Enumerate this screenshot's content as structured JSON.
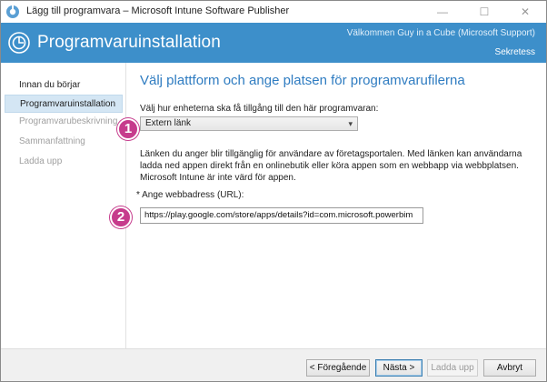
{
  "window": {
    "title": "Lägg till programvara – Microsoft Intune Software Publisher",
    "controls": {
      "minimize": "—",
      "maximize": "☐",
      "close": "✕"
    }
  },
  "banner": {
    "title": "Programvaruinstallation",
    "welcome": "Välkommen Guy in a Cube (Microsoft Support)",
    "privacy_link": "Sekretess"
  },
  "sidebar": {
    "items": [
      {
        "label": "Innan du börjar",
        "state": "normal"
      },
      {
        "label": "Programvaruinstallation",
        "state": "active"
      },
      {
        "label": "Programvarubeskrivning",
        "state": "disabled"
      },
      {
        "label": "Sammanfattning",
        "state": "disabled"
      },
      {
        "label": "Ladda upp",
        "state": "disabled"
      }
    ]
  },
  "main": {
    "heading": "Välj plattform och ange platsen för programvarufilerna",
    "access_label": "Välj hur enheterna ska få tillgång till den här programvaran:",
    "access_select_value": "Extern länk",
    "description": "Länken du anger blir tillgänglig för användare av företagsportalen. Med länken kan användarna ladda ned appen direkt från en onlinebutik eller köra appen som en webbapp via webbplatsen. Microsoft Intune är inte värd för appen.",
    "url_label": "* Ange webbadress (URL):",
    "url_value": "https://play.google.com/store/apps/details?id=com.microsoft.powerbim"
  },
  "callouts": {
    "one": "1",
    "two": "2"
  },
  "footer": {
    "prev_label": "< Föregående",
    "next_label": "Nästa >",
    "upload_label": "Ladda upp",
    "cancel_label": "Avbryt"
  },
  "colors": {
    "banner": "#3d8fca",
    "heading": "#2f7cc1",
    "callout": "#c63b8c",
    "active_step": "#d4e6f4"
  }
}
